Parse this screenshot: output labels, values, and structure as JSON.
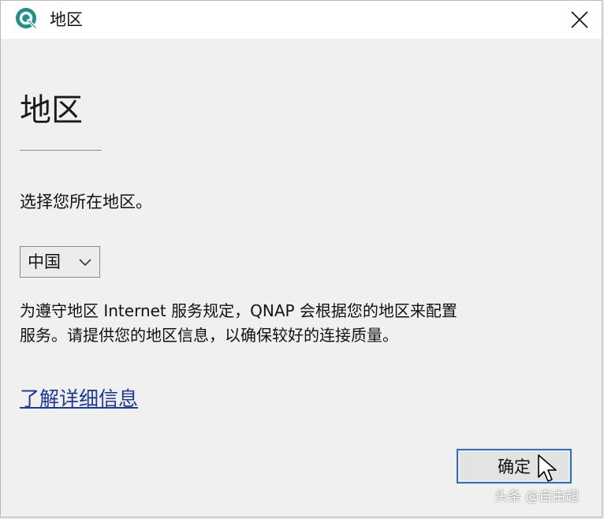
{
  "window": {
    "title": "地区"
  },
  "heading": "地区",
  "prompt": "选择您所在地区。",
  "region_select": {
    "selected": "中国"
  },
  "description": {
    "line1": "为遵守地区 Internet 服务规定，QNAP 会根据您的地区来配置",
    "line2": "服务。请提供您的地区信息，以确保较好的连接质量。"
  },
  "learn_more_link": "了解详细信息",
  "ok_button": "确定",
  "watermark": "头条 @自由超",
  "colors": {
    "accent": "#2b6fd6",
    "link": "#1b3a9a",
    "app_icon": "#1f8f8a"
  },
  "icons": {
    "app": "qnap-q-icon",
    "close": "close-icon",
    "dropdown": "chevron-down-icon",
    "pointer": "mouse-pointer-icon"
  }
}
